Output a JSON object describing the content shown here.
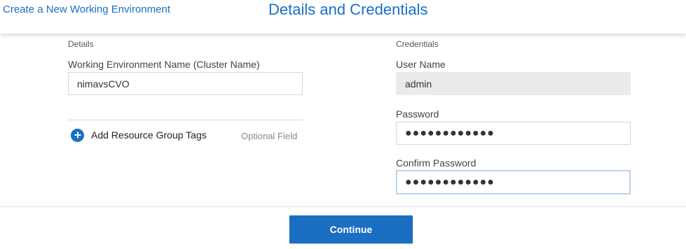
{
  "header": {
    "back_link": "Create a New Working Environment",
    "title": "Details and Credentials"
  },
  "details": {
    "heading": "Details",
    "name_label": "Working Environment Name (Cluster Name)",
    "name_value": "nimavsCVO",
    "add_tags_label": "Add Resource Group Tags",
    "optional_label": "Optional Field"
  },
  "credentials": {
    "heading": "Credentials",
    "username_label": "User Name",
    "username_value": "admin",
    "password_label": "Password",
    "password_value": "●●●●●●●●●●●●",
    "confirm_label": "Confirm Password",
    "confirm_value": "●●●●●●●●●●●●"
  },
  "footer": {
    "continue_label": "Continue"
  },
  "colors": {
    "accent": "#1a6fc3",
    "readonly_bg": "#e9ebec",
    "focus_border": "#b8d3ee"
  }
}
